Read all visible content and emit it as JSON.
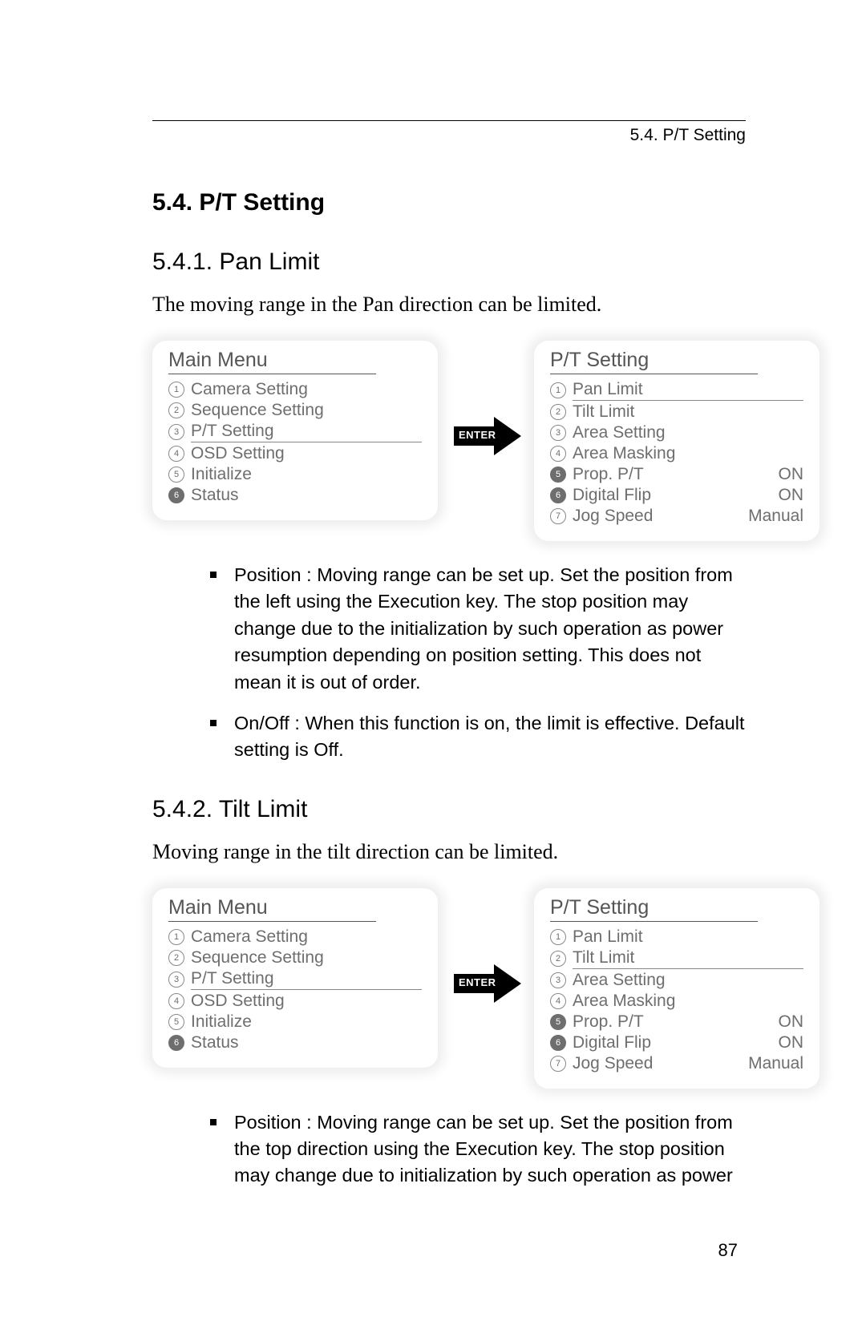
{
  "running_head": "5.4. P/T Setting",
  "section_title": "5.4. P/T Setting",
  "sub1": {
    "heading": "5.4.1. Pan Limit",
    "intro": "The moving range in the Pan direction can be limited.",
    "enter_label": "ENTER",
    "main_menu": {
      "title": "Main Menu",
      "items": [
        {
          "n": "1",
          "label": "Camera Setting",
          "filled": false
        },
        {
          "n": "2",
          "label": "Sequence Setting",
          "filled": false
        },
        {
          "n": "3",
          "label": "P/T Setting",
          "filled": false,
          "selected": true
        },
        {
          "n": "4",
          "label": "OSD Setting",
          "filled": false
        },
        {
          "n": "5",
          "label": "Initialize",
          "filled": false
        },
        {
          "n": "6",
          "label": "Status",
          "filled": true
        }
      ]
    },
    "pt_menu": {
      "title": "P/T Setting",
      "items": [
        {
          "n": "1",
          "label": "Pan Limit",
          "val": "",
          "filled": false,
          "selected": true
        },
        {
          "n": "2",
          "label": "Tilt Limit",
          "val": "",
          "filled": false
        },
        {
          "n": "3",
          "label": "Area Setting",
          "val": "",
          "filled": false
        },
        {
          "n": "4",
          "label": "Area Masking",
          "val": "",
          "filled": false
        },
        {
          "n": "5",
          "label": "Prop. P/T",
          "val": "ON",
          "filled": true
        },
        {
          "n": "6",
          "label": "Digital Flip",
          "val": "ON",
          "filled": true
        },
        {
          "n": "7",
          "label": "Jog Speed",
          "val": "Manual",
          "filled": false
        }
      ]
    },
    "bullets": [
      "Position : Moving range can be set up. Set the position from the left using the Execution key. The stop position may change due to the initialization by such operation as power resumption depending on position setting. This does not mean it is out of order.",
      "On/Off : When this function is on, the limit is effective. Default setting is Off."
    ]
  },
  "sub2": {
    "heading": "5.4.2. Tilt Limit",
    "intro": "Moving range in the tilt direction can be limited.",
    "enter_label": "ENTER",
    "main_menu": {
      "title": "Main Menu",
      "items": [
        {
          "n": "1",
          "label": "Camera Setting",
          "filled": false
        },
        {
          "n": "2",
          "label": "Sequence Setting",
          "filled": false
        },
        {
          "n": "3",
          "label": "P/T Setting",
          "filled": false,
          "selected": true
        },
        {
          "n": "4",
          "label": "OSD Setting",
          "filled": false
        },
        {
          "n": "5",
          "label": "Initialize",
          "filled": false
        },
        {
          "n": "6",
          "label": "Status",
          "filled": true
        }
      ]
    },
    "pt_menu": {
      "title": "P/T Setting",
      "items": [
        {
          "n": "1",
          "label": "Pan Limit",
          "val": "",
          "filled": false
        },
        {
          "n": "2",
          "label": "Tilt Limit",
          "val": "",
          "filled": false,
          "selected": true
        },
        {
          "n": "3",
          "label": "Area Setting",
          "val": "",
          "filled": false
        },
        {
          "n": "4",
          "label": "Area Masking",
          "val": "",
          "filled": false
        },
        {
          "n": "5",
          "label": "Prop. P/T",
          "val": "ON",
          "filled": true
        },
        {
          "n": "6",
          "label": "Digital Flip",
          "val": "ON",
          "filled": true
        },
        {
          "n": "7",
          "label": "Jog Speed",
          "val": "Manual",
          "filled": false
        }
      ]
    },
    "bullets": [
      "Position : Moving range can be set up. Set the position from the top direction using the Execution key. The stop position may change due to initialization by such operation as power"
    ]
  },
  "page_number": "87"
}
